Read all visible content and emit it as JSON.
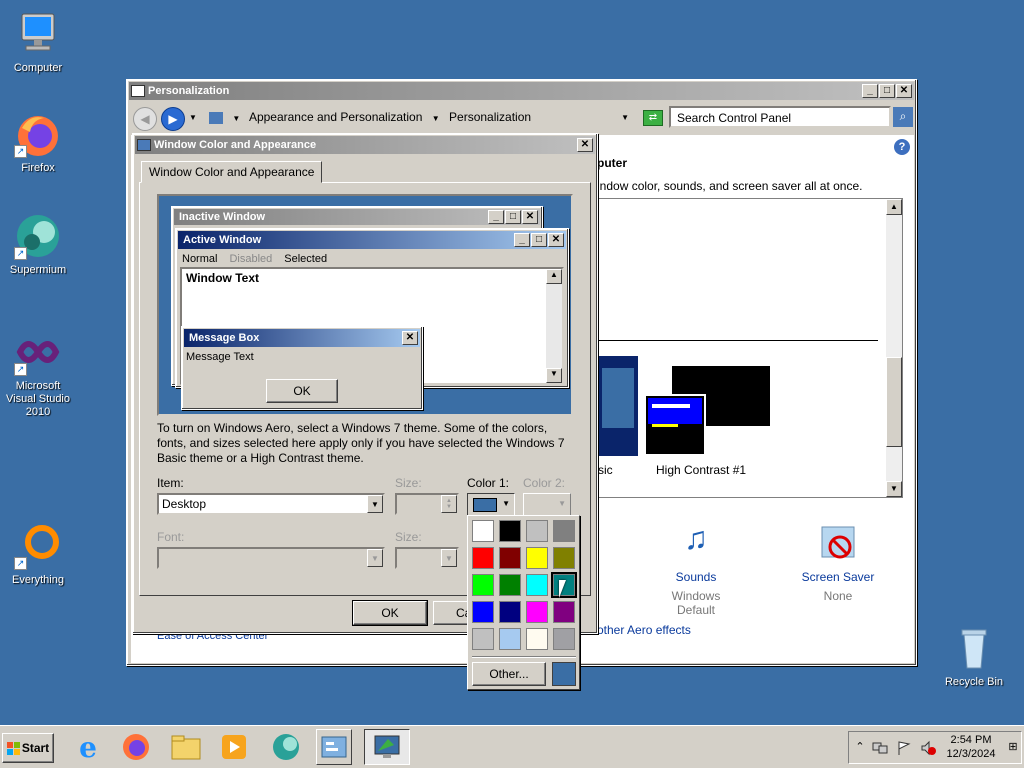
{
  "desktop": {
    "icons": [
      {
        "label": "Computer"
      },
      {
        "label": "Firefox"
      },
      {
        "label": "Supermium"
      },
      {
        "label": "Microsoft Visual Studio 2010"
      },
      {
        "label": "Everything"
      },
      {
        "label": "Recycle Bin"
      }
    ]
  },
  "personalization": {
    "title": "Personalization",
    "breadcrumb": [
      "Appearance and Personalization",
      "Personalization"
    ],
    "search_placeholder": "Search Control Panel",
    "heading_fragment": "puter",
    "desc_fragment": "indow color, sounds, and screen saver all at once.",
    "theme_label_fragment": "sic",
    "theme_high_contrast": "High Contrast #1",
    "sounds_label": "Sounds",
    "sounds_value": "Windows Default",
    "screensaver_label": "Screen Saver",
    "screensaver_value": "None",
    "ease_link": "Ease of Access Center",
    "aero_link": "other Aero effects"
  },
  "dialog": {
    "title": "Window Color and Appearance",
    "tab": "Window Color and Appearance",
    "preview": {
      "inactive": "Inactive Window",
      "active": "Active Window",
      "menu": [
        "Normal",
        "Disabled",
        "Selected"
      ],
      "window_text": "Window Text",
      "msgbox_title": "Message Box",
      "msgbox_text": "Message Text",
      "msgbox_ok": "OK"
    },
    "info": "To turn on Windows Aero, select a Windows 7 theme.  Some of the colors, fonts, and sizes selected here apply only if you have selected the Windows 7 Basic theme or a High Contrast theme.",
    "item_label": "Item:",
    "item_value": "Desktop",
    "size_label": "Size:",
    "color1_label": "Color 1:",
    "color2_label": "Color 2:",
    "font_label": "Font:",
    "size2_label": "Size:",
    "ok": "OK",
    "cancel_fragment": "Ca"
  },
  "palette": {
    "colors": [
      "#ffffff",
      "#000000",
      "#c0c0c0",
      "#808080",
      "#ff0000",
      "#800000",
      "#ffff00",
      "#808000",
      "#00ff00",
      "#008000",
      "#00ffff",
      "#008080",
      "#0000ff",
      "#000080",
      "#ff00ff",
      "#800080",
      "#c0c0c0",
      "#a6caf0",
      "#fffbf0",
      "#a0a0a4"
    ],
    "other_label": "Other...",
    "current_color": "#3a6ea5"
  },
  "taskbar": {
    "start": "Start",
    "time": "2:54 PM",
    "date": "12/3/2024"
  }
}
